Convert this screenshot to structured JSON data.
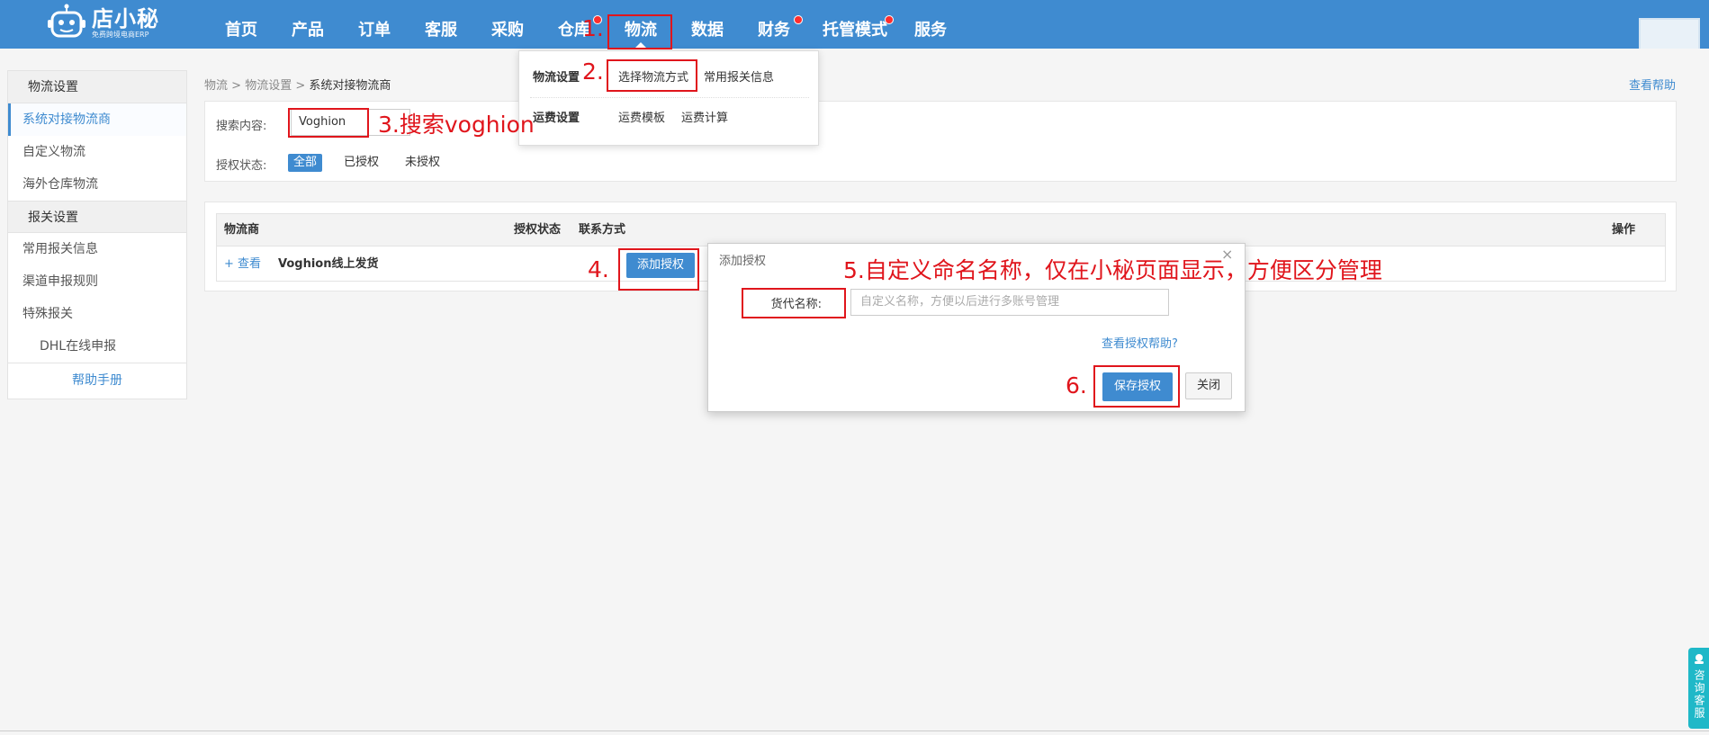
{
  "app": {
    "logo_text": "店小秘",
    "logo_sub": "免费跨境电商ERP"
  },
  "nav": [
    {
      "label": "首页"
    },
    {
      "label": "产品"
    },
    {
      "label": "订单"
    },
    {
      "label": "客服"
    },
    {
      "label": "采购"
    },
    {
      "label": "仓库"
    },
    {
      "label": "物流"
    },
    {
      "label": "数据"
    },
    {
      "label": "财务"
    },
    {
      "label": "托管模式"
    },
    {
      "label": "服务"
    }
  ],
  "dropdown": {
    "group1_title": "物流设置",
    "group1_items": [
      "选择物流方式",
      "常用报关信息"
    ],
    "group2_title": "运费设置",
    "group2_items": [
      "运费模板",
      "运费计算"
    ]
  },
  "sidebar": {
    "section1": "物流设置",
    "items1": [
      "系统对接物流商",
      "自定义物流",
      "海外仓库物流"
    ],
    "section2": "报关设置",
    "items2": [
      "常用报关信息",
      "渠道申报规则",
      "特殊报关",
      "DHL在线申报"
    ],
    "help": "帮助手册"
  },
  "breadcrumb": [
    "物流",
    "物流设置",
    "系统对接物流商"
  ],
  "help_link": "查看帮助",
  "filter": {
    "search_label": "搜索内容:",
    "search_value": "Voghion",
    "status_label": "授权状态:",
    "status_options": [
      "全部",
      "已授权",
      "未授权"
    ],
    "selected": "全部"
  },
  "table": {
    "headers": [
      "物流商",
      "授权状态",
      "联系方式",
      "操作"
    ],
    "rows": [
      {
        "expand": "+ 查看",
        "name": "Voghion线上发货",
        "action": "添加授权"
      }
    ]
  },
  "modal": {
    "title": "添加授权",
    "close_glyph": "×",
    "field_label": "货代名称:",
    "field_placeholder": "自定义名称，方便以后进行多账号管理",
    "help_link": "查看授权帮助?",
    "save": "保存授权",
    "close": "关闭"
  },
  "annotations": {
    "a1": "1.",
    "a2": "2.",
    "a3": "3.搜索voghion",
    "a4": "4.",
    "a5": "5.自定义命名名称，仅在小秘页面显示，方便区分管理",
    "a6": "6."
  },
  "side_tab": "咨询客服",
  "colors": {
    "primary": "#3f8bd0",
    "annotation": "#e0151c",
    "badge": "#ff2d2d",
    "side_tab": "#1fb8c8"
  }
}
